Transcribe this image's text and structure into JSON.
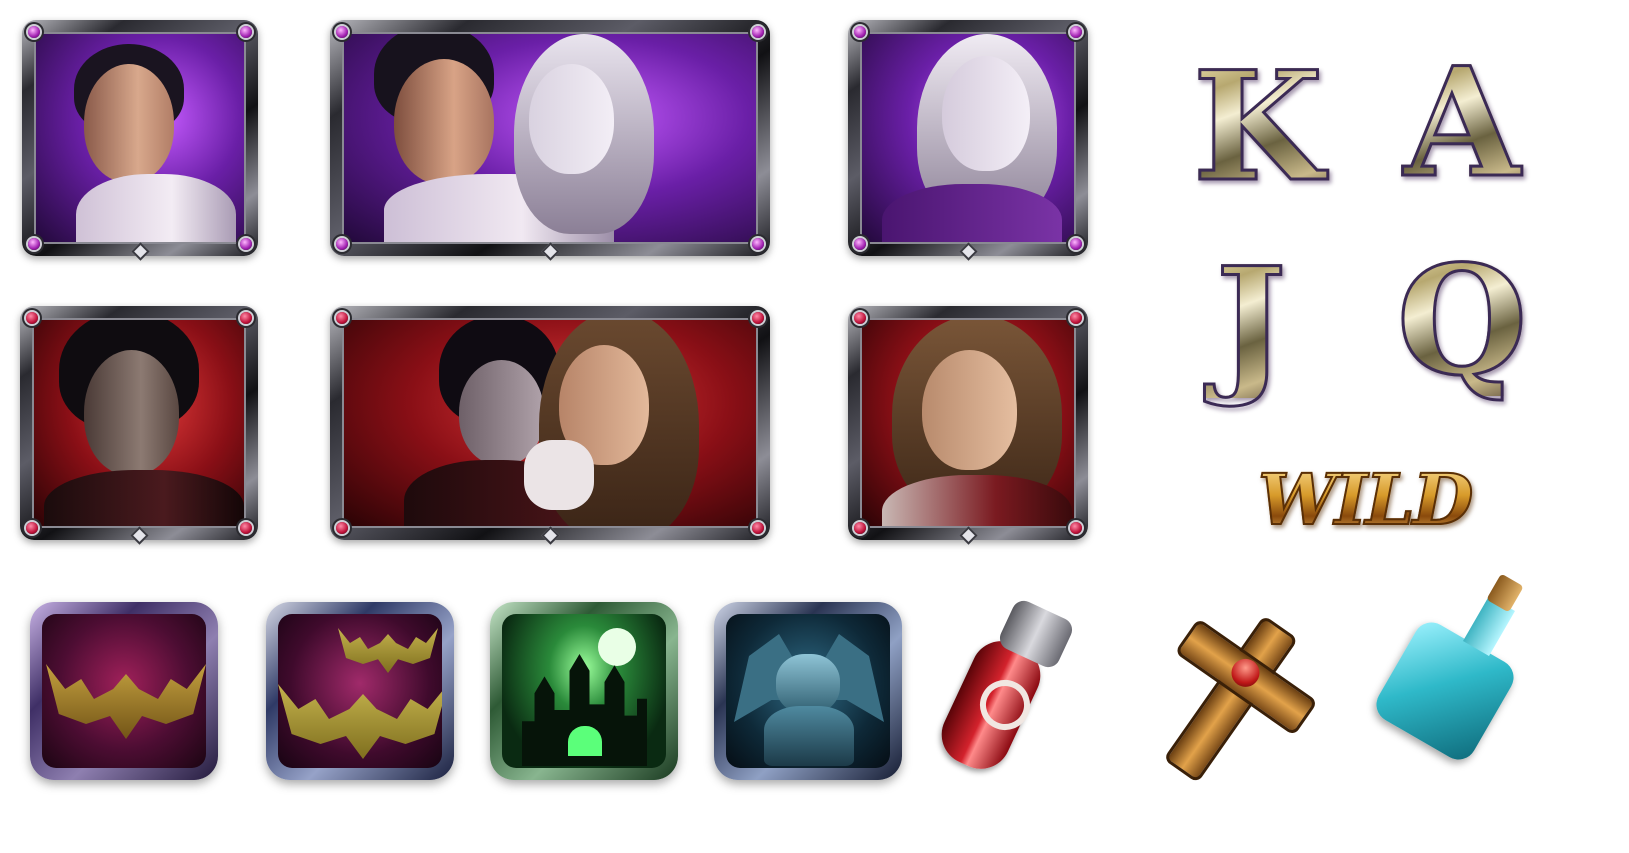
{
  "symbols": {
    "letters": [
      "K",
      "A",
      "J",
      "Q"
    ],
    "wild_label": "WILD"
  },
  "colors": {
    "purple_frame_bg": "#6a1fa7",
    "red_frame_bg": "#8a0f16",
    "gold": "#d79a2a",
    "vial_red": "#b3121c",
    "bottle_teal": "#2fb9c9"
  },
  "icons": {
    "portraits": [
      "man-portrait-icon",
      "couple-portrait-icon",
      "woman-vampire-portrait-icon",
      "vampire-man-portrait-icon",
      "vampire-couple-portrait-icon",
      "woman-portrait-icon"
    ],
    "low_pay": [
      "bat-icon",
      "bats-icon",
      "castle-icon",
      "gargoyle-icon"
    ],
    "items": [
      "blood-vial-icon",
      "cross-icon",
      "potion-bottle-icon"
    ]
  }
}
